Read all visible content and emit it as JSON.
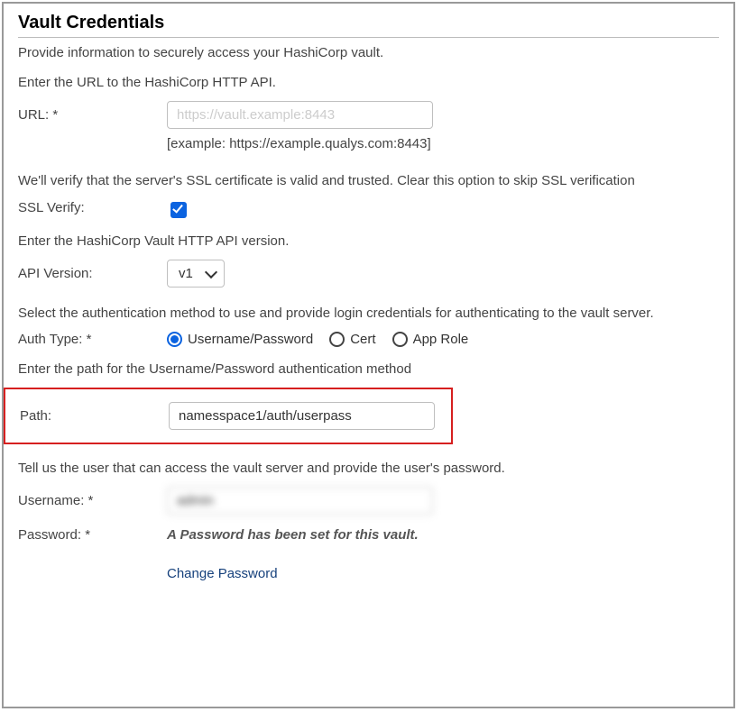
{
  "heading": "Vault Credentials",
  "description": "Provide information to securely access your HashiCorp vault.",
  "url": {
    "instruction": "Enter the URL to the HashiCorp HTTP API.",
    "label": "URL: *",
    "value": "https://vault.example:8443",
    "example": "[example: https://example.qualys.com:8443]"
  },
  "ssl": {
    "instruction": "We'll verify that the server's SSL certificate is valid and trusted. Clear this option to skip SSL verification",
    "label": "SSL Verify:",
    "checked": true
  },
  "api": {
    "instruction": "Enter the HashiCorp Vault HTTP API version.",
    "label": "API Version:",
    "options": [
      "v1"
    ],
    "selected": "v1"
  },
  "auth": {
    "instruction": "Select the authentication method to use and provide login credentials for authenticating to the vault server.",
    "label": "Auth Type: *",
    "options": {
      "userpass": "Username/Password",
      "cert": "Cert",
      "approle": "App Role"
    },
    "selected": "userpass"
  },
  "path": {
    "instruction": "Enter the path for the Username/Password authentication method",
    "label": "Path:",
    "value": "namesspace1/auth/userpass"
  },
  "user": {
    "instruction": "Tell us the user that can access the vault server and provide the user's password.",
    "username_label": "Username: *",
    "username_value": "admin",
    "password_label": "Password: *",
    "password_status": "A Password has been set for this vault.",
    "change_link": "Change Password"
  }
}
